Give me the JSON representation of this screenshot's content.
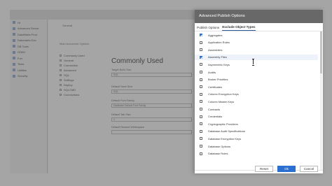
{
  "background_app": {
    "tab_label": "General",
    "subtabs": "Main   Advanced   Options",
    "tree_items": [
      "Ht",
      "Advanced Server",
      "DataMarts Prod",
      "Datamarts Dev",
      "DB Tools",
      "ODBC",
      "Fun",
      "Tests",
      "Utilities",
      "Security"
    ],
    "nav_items": [
      "Commonly Used",
      "General",
      "Connection",
      "Advanced",
      "SQL",
      "Settings",
      "Deploy",
      "SQLCMD",
      "Connections"
    ],
    "heading": "Commonly Used",
    "fields": [
      {
        "label": "Target Build Size",
        "value": "SQL"
      },
      {
        "label": "Default Save Size",
        "value": "SQL"
      },
      {
        "label": "Default Font Family",
        "value": "Database Default Font Family"
      },
      {
        "label": "Default Tab Size",
        "value": "4"
      },
      {
        "label": "Default Reused Whitespace",
        "value": ""
      }
    ]
  },
  "dialog": {
    "title": "Advanced Publish Options",
    "tabs": [
      {
        "label": "Publish Options",
        "active": false
      },
      {
        "label": "Exclude Object Types",
        "active": true
      }
    ],
    "items": [
      {
        "label": "Aggregates",
        "checked": true
      },
      {
        "label": "Application Roles",
        "checked": false
      },
      {
        "label": "Assemblies",
        "checked": false
      },
      {
        "label": "Assembly Files",
        "checked": true
      },
      {
        "label": "Asymmetric Keys",
        "checked": false
      },
      {
        "label": "Audits",
        "checked": false
      },
      {
        "label": "Broker Priorities",
        "checked": false
      },
      {
        "label": "Certificates",
        "checked": false
      },
      {
        "label": "Column Encryption Keys",
        "checked": false
      },
      {
        "label": "Column Master Keys",
        "checked": false
      },
      {
        "label": "Contracts",
        "checked": false
      },
      {
        "label": "Credentials",
        "checked": false
      },
      {
        "label": "Cryptographic Providers",
        "checked": false
      },
      {
        "label": "Database Audit Specifications",
        "checked": false
      },
      {
        "label": "Database Encryption Keys",
        "checked": false
      },
      {
        "label": "Database Options",
        "checked": false
      },
      {
        "label": "Database Roles",
        "checked": false
      }
    ],
    "buttons": {
      "reset": "Reset",
      "ok": "Ok",
      "cancel": "Cancel"
    },
    "accent_color": "#2b6fd0"
  }
}
